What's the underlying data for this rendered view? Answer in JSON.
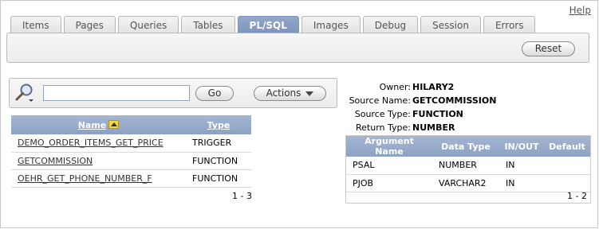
{
  "help": {
    "label": "Help"
  },
  "tabs": [
    {
      "label": "Items",
      "active": false
    },
    {
      "label": "Pages",
      "active": false
    },
    {
      "label": "Queries",
      "active": false
    },
    {
      "label": "Tables",
      "active": false
    },
    {
      "label": "PL/SQL",
      "active": true
    },
    {
      "label": "Images",
      "active": false
    },
    {
      "label": "Debug",
      "active": false
    },
    {
      "label": "Session",
      "active": false
    },
    {
      "label": "Errors",
      "active": false
    }
  ],
  "toolbar": {
    "reset_label": "Reset"
  },
  "search": {
    "value": "",
    "go_label": "Go",
    "actions_label": "Actions"
  },
  "objects_table": {
    "headers": {
      "name": "Name",
      "type": "Type"
    },
    "rows": [
      {
        "name": "DEMO_ORDER_ITEMS_GET_PRICE",
        "type": "TRIGGER"
      },
      {
        "name": "GETCOMMISSION",
        "type": "FUNCTION"
      },
      {
        "name": "OEHR_GET_PHONE_NUMBER_F",
        "type": "FUNCTION"
      }
    ],
    "pagination": "1 - 3"
  },
  "details": {
    "owner_label": "Owner:",
    "owner": "HILARY2",
    "source_name_label": "Source Name:",
    "source_name": "GETCOMMISSION",
    "source_type_label": "Source Type:",
    "source_type": "FUNCTION",
    "return_type_label": "Return Type:",
    "return_type": "NUMBER"
  },
  "arguments_table": {
    "headers": {
      "argument_name": "Argument Name",
      "data_type": "Data Type",
      "in_out": "IN/OUT",
      "default": "Default"
    },
    "rows": [
      {
        "argument_name": "PSAL",
        "data_type": "NUMBER",
        "in_out": "IN",
        "default": ""
      },
      {
        "argument_name": "PJOB",
        "data_type": "VARCHAR2",
        "in_out": "IN",
        "default": ""
      }
    ],
    "pagination": "1 - 2"
  },
  "colors": {
    "tab_active": "#8499c0",
    "header_bg": "#97aacb",
    "border": "#b9b9b9"
  },
  "icons": {
    "search": "magnifier-icon",
    "actions_caret": "chevron-down-icon",
    "sort": "sort-ascending-icon"
  }
}
